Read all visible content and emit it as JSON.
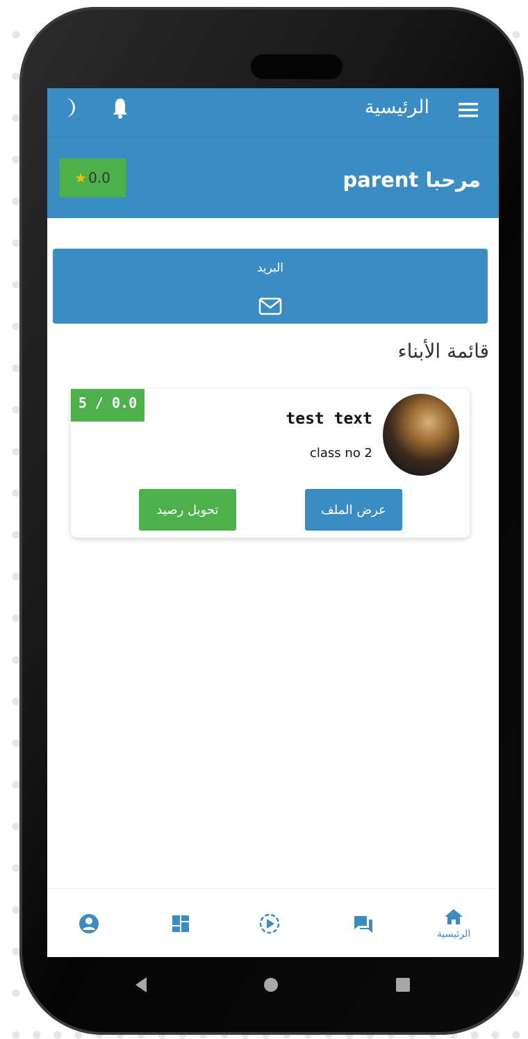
{
  "header": {
    "title": "الرئيسية",
    "menu_icon": "hamburger-menu-icon",
    "notification_icon": "bell-icon",
    "theme_icon": "moon-icon"
  },
  "welcome": {
    "text": "مرحبا parent",
    "rating": "0.0",
    "rating_icon": "star-icon"
  },
  "mail_button": {
    "label": "البريد",
    "icon": "envelope-icon"
  },
  "children_section": {
    "title": "قائمة الأبناء",
    "children": [
      {
        "name": "test text",
        "class": "class no 2",
        "score": "5 / 0.0",
        "view_profile_label": "عرض الملف",
        "transfer_balance_label": "تحويل رصيد"
      }
    ]
  },
  "bottom_nav": {
    "items": [
      {
        "icon": "home-icon",
        "label": "الرئيسية",
        "active": true
      },
      {
        "icon": "chat-icon",
        "label": ""
      },
      {
        "icon": "play-circle-icon",
        "label": ""
      },
      {
        "icon": "dashboard-icon",
        "label": ""
      },
      {
        "icon": "account-circle-icon",
        "label": ""
      }
    ]
  },
  "colors": {
    "primary": "#3b8cc2",
    "success": "#4db04a",
    "star": "#f2c100"
  }
}
